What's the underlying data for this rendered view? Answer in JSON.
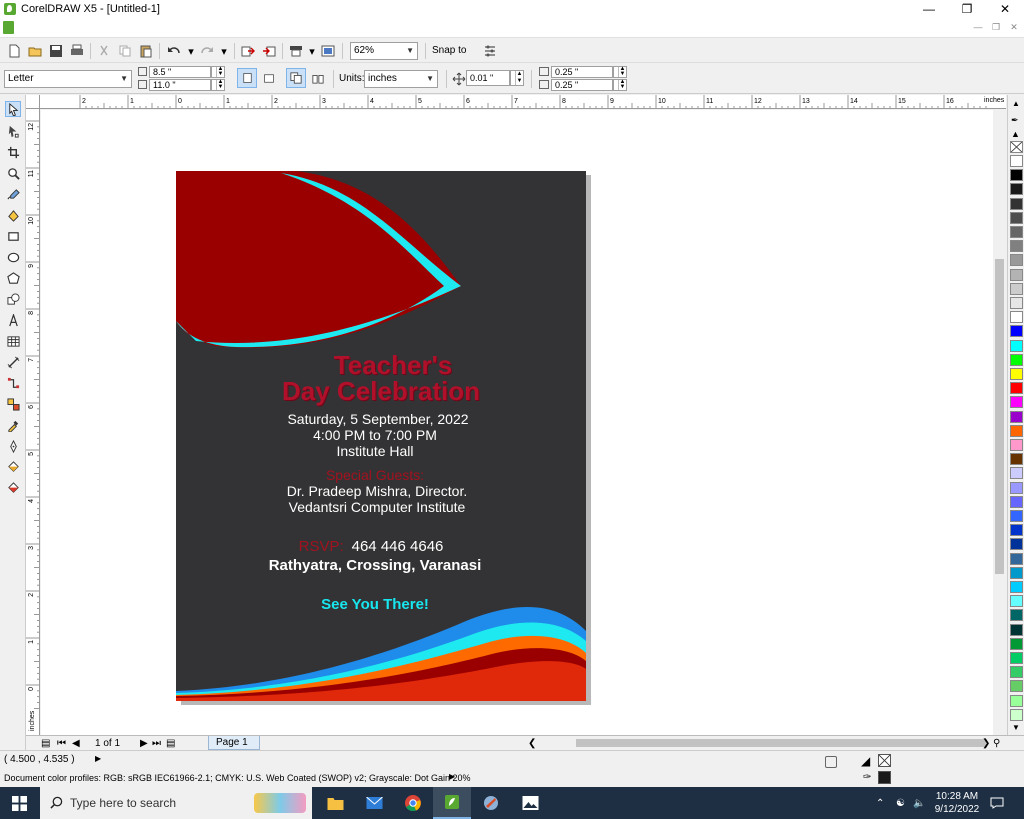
{
  "window": {
    "title": "CorelDRAW X5 - [Untitled-1]"
  },
  "toolbar": {
    "zoom": "62%",
    "snap_to": "Snap to"
  },
  "property_bar": {
    "paper_type": "Letter",
    "width": "8.5 \"",
    "height": "11.0 \"",
    "units_label": "Units:",
    "units": "inches",
    "nudge": "0.01 \"",
    "dup_x": "0.25 \"",
    "dup_y": "0.25 \""
  },
  "ruler": {
    "h_ticks": [
      "2",
      "1",
      "0",
      "1",
      "2",
      "3",
      "4",
      "5",
      "6",
      "7",
      "8",
      "9",
      "10",
      "11",
      "12",
      "13",
      "14",
      "15",
      "16"
    ],
    "h_unit": "inches",
    "v_ticks": [
      "12",
      "11",
      "10",
      "9",
      "8",
      "7",
      "6",
      "5",
      "4",
      "3",
      "2",
      "1",
      "0"
    ],
    "v_unit": "inches"
  },
  "poster": {
    "title_line1": "Teacher's",
    "title_line2": "Day Celebration",
    "date": "Saturday, 5 September, 2022",
    "time": "4:00 PM to 7:00 PM",
    "venue": "Institute Hall",
    "guests_heading": "Special Guests:",
    "guest_name": "Dr. Pradeep Mishra, Director.",
    "guest_org": "Vedantsri Computer Institute",
    "rsvp_label": "RSVP:",
    "phone": "464 446 4646",
    "address": "Rathyatra, Crossing, Varanasi",
    "closing": "See You There!",
    "colors": {
      "background": "#333335",
      "leaf": "#9b0000",
      "cyan": "#1ee8f0",
      "orange": "#ff6a00",
      "red": "#e0280a",
      "blue": "#1f8bea",
      "title": "#b0102a"
    }
  },
  "page_nav": {
    "count": "1 of 1",
    "tab": "Page 1"
  },
  "status": {
    "coords": "( 4.500 , 4.535 )",
    "profile": "Document color profiles: RGB: sRGB IEC61966-2.1; CMYK: U.S. Web Coated (SWOP) v2; Grayscale: Dot Gain 20%"
  },
  "palette": [
    "#ffffff",
    "#000000",
    "#1a1a1a",
    "#333333",
    "#4d4d4d",
    "#666666",
    "#808080",
    "#999999",
    "#b3b3b3",
    "#cccccc",
    "#e6e6e6",
    "#ffffff",
    "#0000ff",
    "#00ffff",
    "#00ff00",
    "#ffff00",
    "#ff0000",
    "#ff00ff",
    "#9900cc",
    "#ff6600",
    "#ff99cc",
    "#663300",
    "#ccccff",
    "#9999ff",
    "#6666ff",
    "#3366ff",
    "#0033cc",
    "#003399",
    "#336699",
    "#0099cc",
    "#00ccff",
    "#66ffff",
    "#006666",
    "#003333",
    "#009933",
    "#00cc66",
    "#33cc66",
    "#66cc66",
    "#99ff99",
    "#ccffcc"
  ],
  "taskbar": {
    "search_placeholder": "Type here to search",
    "time": "10:28 AM",
    "date": "9/12/2022"
  }
}
